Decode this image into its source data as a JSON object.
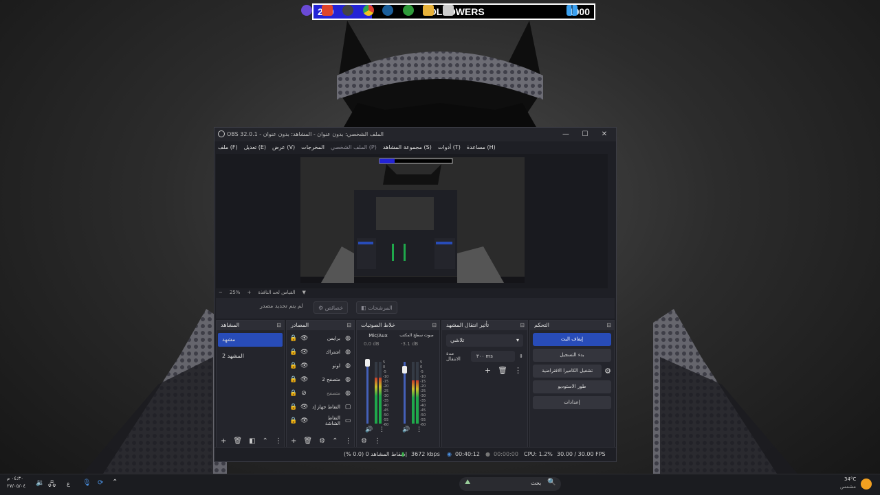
{
  "followers": {
    "current": "209",
    "label": "FOLLOWERS",
    "goal": "1000",
    "fraction": 0.209
  },
  "window": {
    "title": "OBS 32.0.1 - الملف الشخصي: بدون عنوان - المشاهد: بدون عنوان",
    "minimize": "—",
    "maximize": "☐",
    "close": "✕"
  },
  "menu": [
    {
      "label": "ملف (F)"
    },
    {
      "label": "تعديل (E)"
    },
    {
      "label": "عرض (V)"
    },
    {
      "label": "المخرجات"
    },
    {
      "label": "الملف الشخصي (P)"
    },
    {
      "label": "مجموعة المشاهد (S)"
    },
    {
      "label": "أدوات (T)"
    },
    {
      "label": "مساعدة (H)"
    }
  ],
  "zoom": {
    "minus": "−",
    "value": "25%",
    "plus": "+",
    "fit": "القياس لحد النافذة"
  },
  "context": {
    "no_source": "لم يتم تحديد مصدر",
    "properties": "خصائص",
    "filters": "المرشحات"
  },
  "scenes": {
    "title": "المشاهد",
    "items": [
      {
        "label": "مشهد"
      },
      {
        "label": "المشهد 2"
      }
    ]
  },
  "sources": {
    "title": "المصادر",
    "items": [
      {
        "label": "برايمن"
      },
      {
        "label": "اشتراك"
      },
      {
        "label": "لوتو"
      },
      {
        "label": "متصفح 2"
      },
      {
        "label": "متصفح"
      },
      {
        "label": "التقاط جهاز إد"
      },
      {
        "label": "التقاط الشاشة"
      }
    ]
  },
  "mixer": {
    "title": "خلاط الصوتيات",
    "channels": [
      {
        "name": "Mic/Aux",
        "db": "0.0 dB",
        "level": 0.75
      },
      {
        "name": "صوت سطح المكتب",
        "db": "-3.1 dB",
        "level": 0.7
      }
    ],
    "scale": [
      "5",
      "0",
      "-5",
      "-10",
      "-15",
      "-20",
      "-25",
      "-30",
      "-35",
      "-40",
      "-45",
      "-50",
      "-55",
      "-60"
    ]
  },
  "transitions": {
    "title": "تأثير انتقال المشهد",
    "selected": "تلاشي",
    "duration_label": "مدة الانتقال",
    "duration_value": "٣٠٠ ms"
  },
  "controls": {
    "title": "التحكم",
    "buttons": [
      {
        "label": "إيقاف البث"
      },
      {
        "label": "بدء التسجيل"
      },
      {
        "label": "تشغيل الكاميرا الافتراضية"
      },
      {
        "label": "طور الاستوديو"
      },
      {
        "label": "إعدادات"
      }
    ]
  },
  "status": {
    "dropped": "إسقاط المشاهد 0 (0.0 %)",
    "bitrate": "3672 kbps",
    "stream_time": "00:40:12",
    "rec_time": "00:00:00",
    "cpu": "CPU: 1.2%",
    "fps": "30.00 / 30.00 FPS"
  },
  "taskbar": {
    "weather_temp": "34°C",
    "weather_desc": "مشمس",
    "search_placeholder": "بحث",
    "clock_time": "٠٤:٣٠ م",
    "clock_date": "٢٧/٠٥/٠٤",
    "lang": "ع"
  },
  "colors": {
    "accent": "#284cb8",
    "follower_fill": "#2323d6"
  }
}
